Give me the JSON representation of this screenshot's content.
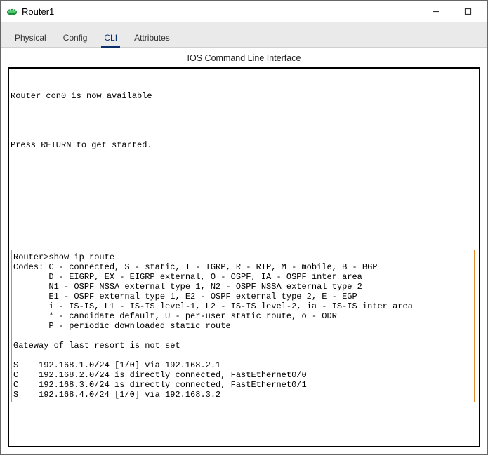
{
  "window": {
    "title": "Router1"
  },
  "tabs": {
    "physical": "Physical",
    "config": "Config",
    "cli": "CLI",
    "attributes": "Attributes"
  },
  "cli_header": "IOS Command Line Interface",
  "cli": {
    "line1": "Router con0 is now available",
    "line2": "Press RETURN to get started.",
    "cmd": "Router>show ip route",
    "codes_head": "Codes: C - connected, S - static, I - IGRP, R - RIP, M - mobile, B - BGP",
    "codes_d": "       D - EIGRP, EX - EIGRP external, O - OSPF, IA - OSPF inter area",
    "codes_n1": "       N1 - OSPF NSSA external type 1, N2 - OSPF NSSA external type 2",
    "codes_e1": "       E1 - OSPF external type 1, E2 - OSPF external type 2, E - EGP",
    "codes_i": "       i - IS-IS, L1 - IS-IS level-1, L2 - IS-IS level-2, ia - IS-IS inter area",
    "codes_star": "       * - candidate default, U - per-user static route, o - ODR",
    "codes_p": "       P - periodic downloaded static route",
    "gateway": "Gateway of last resort is not set",
    "route_s1": "S    192.168.1.0/24 [1/0] via 192.168.2.1",
    "route_c1": "C    192.168.2.0/24 is directly connected, FastEthernet0/0",
    "route_c2": "C    192.168.3.0/24 is directly connected, FastEthernet0/1",
    "route_s2": "S    192.168.4.0/24 [1/0] via 192.168.3.2"
  }
}
